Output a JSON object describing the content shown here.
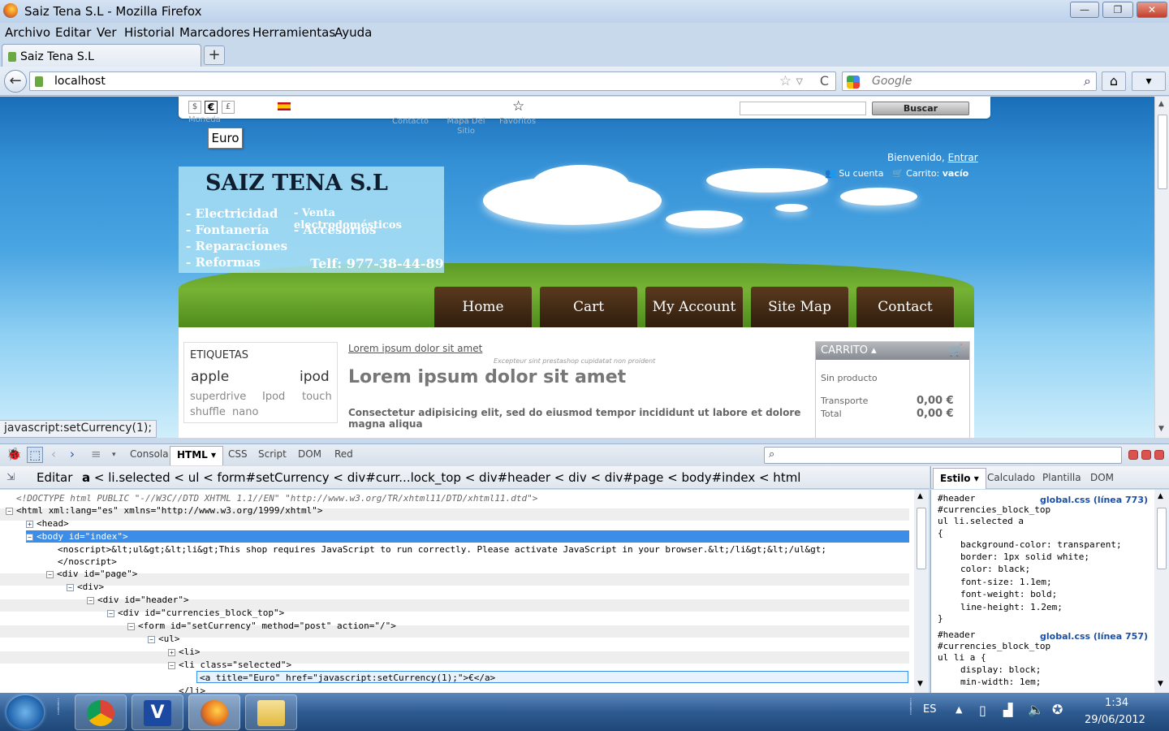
{
  "window": {
    "title": "Saiz Tena S.L - Mozilla Firefox",
    "min": "—",
    "max": "❐",
    "close": "✕"
  },
  "menu": [
    "Archivo",
    "Editar",
    "Ver",
    "Historial",
    "Marcadores",
    "Herramientas",
    "Ayuda"
  ],
  "tab": {
    "label": "Saiz Tena S.L",
    "new": "+"
  },
  "nav": {
    "back": "←",
    "url": "localhost",
    "star": "☆ ▿",
    "reload": "C",
    "search_placeholder": "Google",
    "search_icon": "⌕",
    "home": "⌂",
    "addon": "▾"
  },
  "site": {
    "currencies": [
      "$",
      "€",
      "£"
    ],
    "tiny_moneda": "Moneda",
    "tiny_contacto": "Contacto",
    "tiny_mapa": "Mapa Del Sitio",
    "tiny_favoritos": "Favoritos",
    "star": "☆",
    "search_button": "Buscar",
    "tooltip": "Euro",
    "welcome": "Bienvenido,",
    "login": "Entrar",
    "account": "Su cuenta",
    "cart_label": "Carrito:",
    "cart_value": "vacío",
    "company": "SAIZ TENA S.L",
    "services_left": [
      "- Electricidad",
      "- Fontanería",
      "- Reparaciones",
      "- Reformas"
    ],
    "services_right": [
      "- Venta electrodomésticos",
      "- Accesorios"
    ],
    "phone": "Telf: 977-38-44-89",
    "menu": [
      "Home",
      "Cart",
      "My Account",
      "Site Map",
      "Contact"
    ],
    "tags_title": "ETIQUETAS",
    "tags": [
      "apple",
      "ipod",
      "superdrive",
      "Ipod",
      "touch",
      "shuffle",
      "nano"
    ],
    "breadcrumb_link": "Lorem ipsum dolor sit amet",
    "small": "Excepteur sint prestashop cupidatat non proident",
    "heading": "Lorem ipsum dolor sit amet",
    "paragraph": "Consectetur adipisicing elit, sed do eiusmod tempor incididunt ut labore et dolore magna aliqua",
    "cart": {
      "title": "CARRITO ▴",
      "empty": "Sin producto",
      "transport": "Transporte",
      "transport_val": "0,00 €",
      "total": "Total",
      "total_val": "0,00 €"
    }
  },
  "statusbar": "javascript:setCurrency(1);",
  "firebug": {
    "tabs": [
      "Consola",
      "HTML ▾",
      "CSS",
      "Script",
      "DOM",
      "Red"
    ],
    "edit": "Editar",
    "crumbs_first": "a",
    "crumbs_rest": "< li.selected < ul < form#setCurrency < div#curr...lock_top < div#header < div < div#page < body#index < html",
    "side_tabs": [
      "Estilo ▾",
      "Calculado",
      "Plantilla",
      "DOM"
    ],
    "lines": [
      "<!DOCTYPE html PUBLIC \"-//W3C//DTD XHTML 1.1//EN\" \"http://www.w3.org/TR/xhtml11/DTD/xhtml11.dtd\">",
      "<html xml:lang=\"es\" xmlns=\"http://www.w3.org/1999/xhtml\">",
      "<head>",
      "<body id=\"index\">",
      "<noscript>&lt;ul&gt;&lt;li&gt;This shop requires JavaScript to run correctly. Please activate JavaScript in your browser.&lt;/li&gt;&lt;/ul&gt;",
      "</noscript>",
      "<div id=\"page\">",
      "<div>",
      "<div id=\"header\">",
      "<div id=\"currencies_block_top\">",
      "<form id=\"setCurrency\" method=\"post\" action=\"/\">",
      "<ul>",
      "<li>",
      "<li class=\"selected\">",
      "<a title=\"Euro\" href=\"javascript:setCurrency(1);\">€</a>",
      "</li>"
    ],
    "rules": [
      {
        "sel": [
          "#header",
          "#currencies_block_top",
          "ul li.selected a"
        ],
        "src": "global.css (línea 773)",
        "open": "{",
        "decls": [
          "background-color: transparent;",
          "border: 1px solid white;",
          "color: black;",
          "font-size: 1.1em;",
          "font-weight: bold;",
          "line-height: 1.2em;"
        ],
        "close": "}"
      },
      {
        "sel": [
          "#header",
          "#currencies_block_top",
          "ul li a {"
        ],
        "src": "global.css (línea 757)",
        "decls": [
          "display: block;",
          "min-width: 1em;"
        ]
      }
    ]
  },
  "tray": {
    "lang": "ES",
    "time": "1:34",
    "date": "29/06/2012"
  }
}
